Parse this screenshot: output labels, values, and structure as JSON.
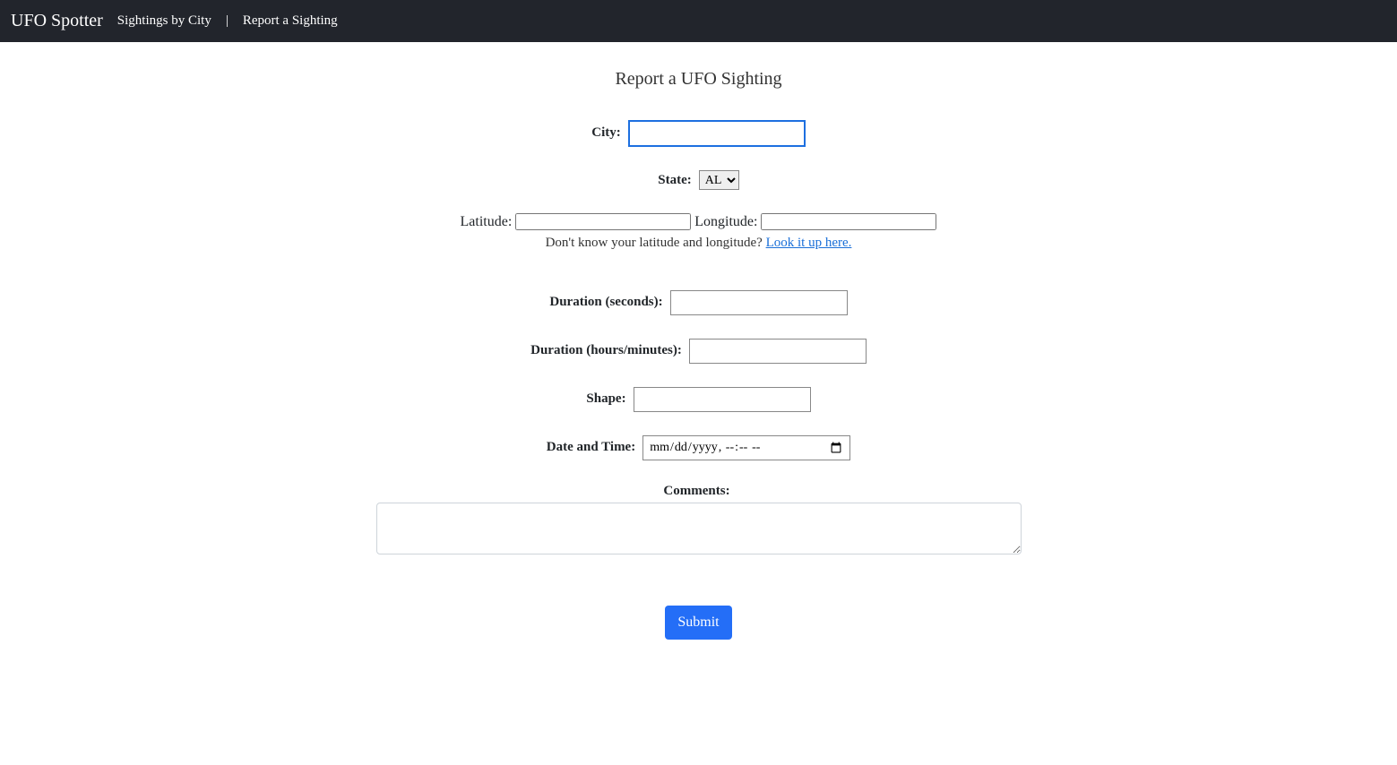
{
  "nav": {
    "brand": "UFO Spotter",
    "link1": "Sightings by City",
    "separator": "|",
    "link2": "Report a Sighting"
  },
  "page": {
    "title": "Report a UFO Sighting"
  },
  "form": {
    "city_label": "City:",
    "city_value": "",
    "state_label": "State:",
    "state_selected": "AL",
    "latitude_label": "Latitude:",
    "latitude_value": "",
    "longitude_label": "Longitude:",
    "longitude_value": "",
    "latlon_hint_text": "Don't know your latitude and longitude? ",
    "latlon_hint_link": "Look it up here.",
    "duration_sec_label": "Duration (seconds):",
    "duration_sec_value": "",
    "duration_hm_label": "Duration (hours/minutes):",
    "duration_hm_value": "",
    "shape_label": "Shape:",
    "shape_value": "",
    "datetime_label": "Date and Time:",
    "datetime_placeholder": "mm/dd/yyyy, --:-- --",
    "datetime_value": "",
    "comments_label": "Comments:",
    "comments_value": "",
    "submit_label": "Submit"
  }
}
